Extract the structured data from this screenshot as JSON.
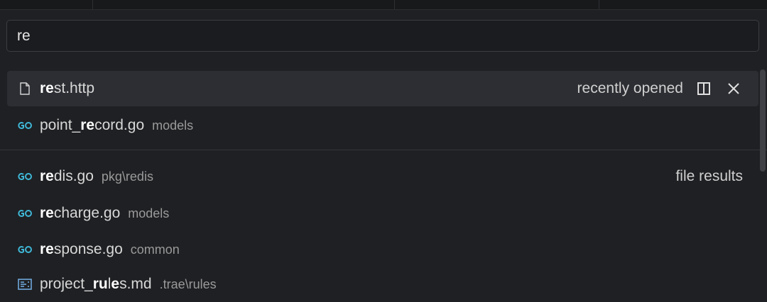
{
  "search": {
    "value": "re"
  },
  "sections": {
    "recent_label": "recently opened",
    "files_label": "file results"
  },
  "items": [
    {
      "match": "re",
      "rest": "st.http",
      "path": "",
      "icon": "file-icon"
    },
    {
      "pre": "point_",
      "match": "re",
      "rest": "cord.go",
      "path": "models",
      "icon": "go-icon"
    },
    {
      "match": "re",
      "rest": "dis.go",
      "path": "pkg\\redis",
      "icon": "go-icon"
    },
    {
      "match": "re",
      "rest": "charge.go",
      "path": "models",
      "icon": "go-icon"
    },
    {
      "match": "re",
      "rest": "sponse.go",
      "path": "common",
      "icon": "go-icon"
    },
    {
      "pre": "project_",
      "match": "ru",
      "mid": "l",
      "match2": "e",
      "rest": "s.md",
      "path": ".trae\\rules",
      "icon": "markdown-icon"
    }
  ],
  "colors": {
    "go": "#3fb6d6",
    "selected_bg": "#2d2e33",
    "background": "#1f2023",
    "markdown": "#6fa8dc"
  }
}
